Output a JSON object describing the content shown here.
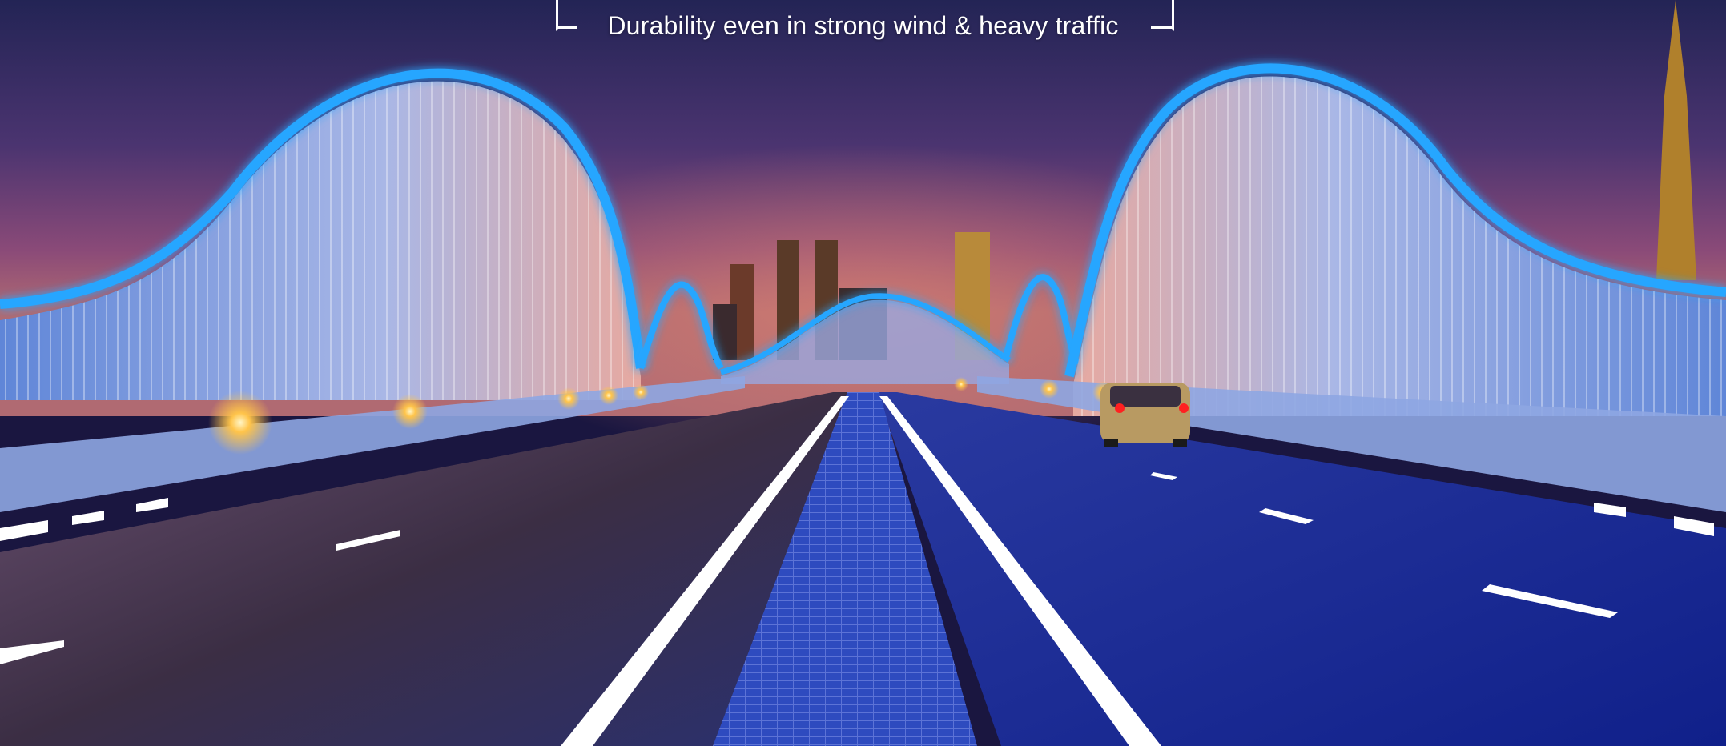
{
  "caption": {
    "subtitle": "Durability even in strong wind & heavy traffic"
  },
  "colors": {
    "sky_top": "#2a2858",
    "sky_mid": "#6a3b78",
    "sky_glow": "#c36a6a",
    "arch_neon": "#27a6ff",
    "arch_body": "#9fb8e8",
    "road_left": "#3a2f40",
    "road_right": "#1a2a8a",
    "lane_marking": "#ffffff",
    "light_warm": "#ffc44a",
    "car_tail": "#ff2020"
  },
  "scene": {
    "description_icons": [
      "bridge-arch",
      "city-skyline",
      "car",
      "street-lights"
    ]
  }
}
